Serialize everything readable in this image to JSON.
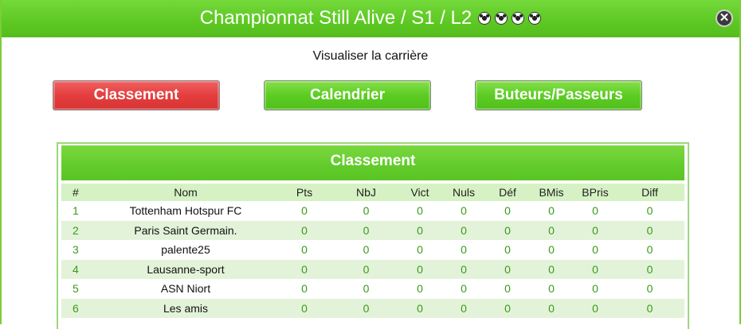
{
  "window": {
    "title": "Championnat Still Alive / S1 / L2",
    "balls": [
      "soccer-ball-icon",
      "soccer-ball-icon",
      "soccer-ball-icon",
      "soccer-ball-icon"
    ],
    "close_label": "✕"
  },
  "subtitle": "Visualiser la carrière",
  "buttons": {
    "classement": "Classement",
    "calendrier": "Calendrier",
    "buteurs": "Buteurs/Passeurs"
  },
  "panel": {
    "title": "Classement",
    "columns": [
      "#",
      "Nom",
      "Pts",
      "NbJ",
      "Vict",
      "Nuls",
      "Déf",
      "BMis",
      "BPris",
      "Diff"
    ],
    "rows": [
      [
        "1",
        "Tottenham Hotspur FC",
        "0",
        "0",
        "0",
        "0",
        "0",
        "0",
        "0",
        "0"
      ],
      [
        "2",
        "Paris Saint Germain.",
        "0",
        "0",
        "0",
        "0",
        "0",
        "0",
        "0",
        "0"
      ],
      [
        "3",
        "palente25",
        "0",
        "0",
        "0",
        "0",
        "0",
        "0",
        "0",
        "0"
      ],
      [
        "4",
        "Lausanne-sport",
        "0",
        "0",
        "0",
        "0",
        "0",
        "0",
        "0",
        "0"
      ],
      [
        "5",
        "ASN Niort",
        "0",
        "0",
        "0",
        "0",
        "0",
        "0",
        "0",
        "0"
      ],
      [
        "6",
        "Les amis",
        "0",
        "0",
        "0",
        "0",
        "0",
        "0",
        "0",
        "0"
      ]
    ]
  },
  "colors": {
    "accent_green": "#5dc823",
    "active_red": "#e43e3e",
    "row_alt": "#e3f3d9",
    "value_green": "#3a9a1a"
  }
}
